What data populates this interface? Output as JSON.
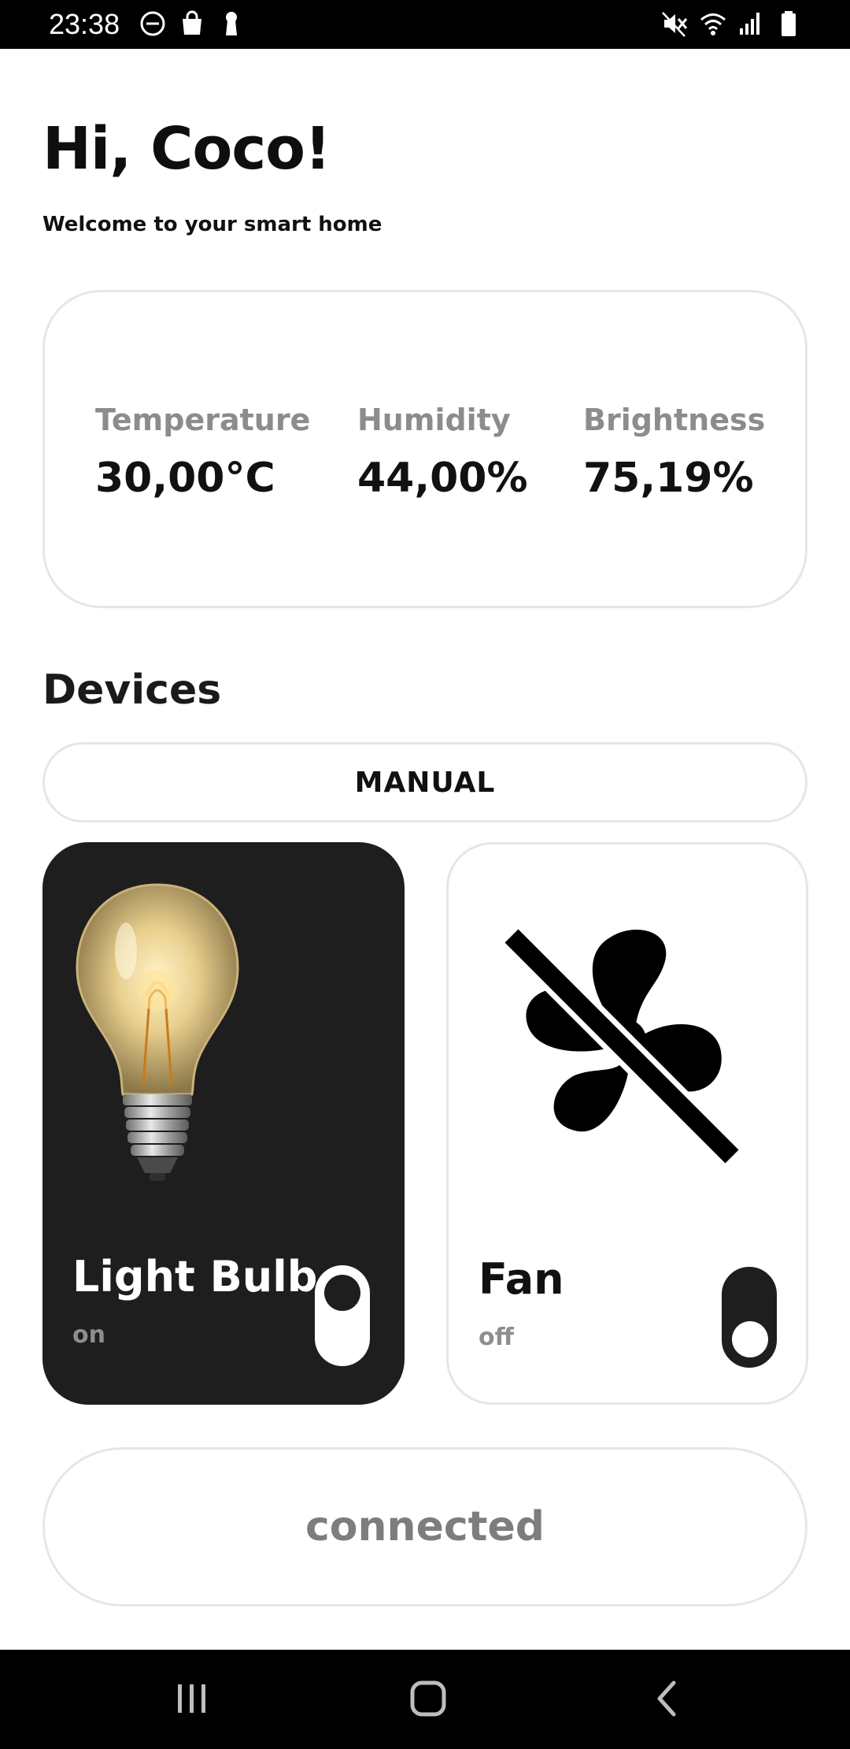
{
  "status_bar": {
    "time": "23:38",
    "left_icons": [
      "do-not-disturb-icon",
      "shopping-bag-icon",
      "keyhole-icon"
    ],
    "right_icons": [
      "mute-icon",
      "wifi-icon",
      "signal-icon",
      "battery-icon"
    ]
  },
  "header": {
    "greeting": "Hi, Coco!",
    "subtitle": "Welcome to your smart home"
  },
  "sensors": [
    {
      "label": "Temperature",
      "value": "30,00°C"
    },
    {
      "label": "Humidity",
      "value": "44,00%"
    },
    {
      "label": "Brightness",
      "value": "75,19%"
    }
  ],
  "devices": {
    "title": "Devices",
    "mode_label": "MANUAL",
    "items": [
      {
        "name": "Light Bulb",
        "state": "on",
        "icon": "light-bulb-image",
        "toggled": true
      },
      {
        "name": "Fan",
        "state": "off",
        "icon": "fan-off-icon",
        "toggled": false
      }
    ]
  },
  "connection": {
    "status": "connected"
  },
  "nav_bar": {
    "icons": [
      "recent-apps-icon",
      "home-icon",
      "back-icon"
    ]
  },
  "colors": {
    "dark_card": "#1e1e1e",
    "muted_text": "#8c8c8c",
    "border": "#e6e6e6"
  }
}
